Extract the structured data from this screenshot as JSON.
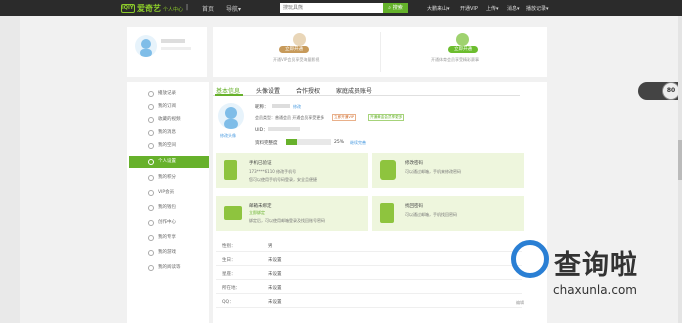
{
  "topbar": {
    "logo_text": "爱奇艺",
    "logo_badge": "iQIYI",
    "logo_sub": "个人中心",
    "nav": [
      "首页",
      "导航▾"
    ],
    "search_placeholder": "搜玩具熊",
    "search_button": "搜索",
    "right": [
      "大鹏来山▾",
      "开通VIP",
      "上传▾",
      "消息▾",
      "播放记录▾"
    ]
  },
  "profile": {
    "vip_cards": [
      {
        "button": "立即开通",
        "desc": "开通VIP会员享受海量影视",
        "color": "#c79a5a"
      },
      {
        "button": "立即开通",
        "desc": "开通体育会员享受精彩赛事",
        "color": "#6cbd2e"
      }
    ]
  },
  "sidebar": {
    "items": [
      {
        "label": "播放记录"
      },
      {
        "label": "我的订阅"
      },
      {
        "label": "收藏的视频"
      },
      {
        "label": "我的消息"
      },
      {
        "label": "我的空间"
      },
      {
        "label": "个人设置",
        "active": true
      },
      {
        "label": "我的积分"
      },
      {
        "label": "VIP会员"
      },
      {
        "label": "我的钱包"
      },
      {
        "label": "创作中心"
      },
      {
        "label": "我的专享"
      },
      {
        "label": "我的游戏"
      },
      {
        "label": "我的阅读等"
      }
    ]
  },
  "tabs": [
    "基本信息",
    "头像设置",
    "合作授权",
    "家庭成员账号"
  ],
  "basic": {
    "nick_label": "昵称：",
    "nick_suffix": "修改",
    "member_label": "会员类型：普通会员 开通会员享受更多",
    "member_tags": [
      "立即开通VIP",
      "开通黄金会员享更多"
    ],
    "uid_label": "UID：",
    "complete_label": "资料完整度",
    "complete_percent": "25%",
    "complete_link": "继续完善",
    "complete_fraction": 0.25,
    "avatar_link": "修改头像"
  },
  "cards": [
    {
      "title": "手机已验证",
      "line1": "173****6110   修改手机号",
      "line2": "您可以使用手机号码登录，安全且便捷"
    },
    {
      "title": "修改密码",
      "line1": "可以通过邮箱，手机来修改密码",
      "line2": ""
    },
    {
      "title": "邮箱未绑定",
      "line1": "立即绑定",
      "line2": "绑定后，可以使用邮箱登录及找回账号密码"
    },
    {
      "title": "找回密码",
      "line1": "可以通过邮箱，手机找回密码",
      "line2": ""
    }
  ],
  "info_rows": [
    {
      "key": "性别：",
      "value": "男"
    },
    {
      "key": "生日：",
      "value": "未设置"
    },
    {
      "key": "星座：",
      "value": "未设置"
    },
    {
      "key": "所在地：",
      "value": "未设置"
    },
    {
      "key": "QQ：",
      "value": "未设置"
    }
  ],
  "info_edit": "编辑",
  "float": {
    "number": "80"
  },
  "watermark": {
    "text": "查询啦",
    "url": "chaxunla.com"
  }
}
